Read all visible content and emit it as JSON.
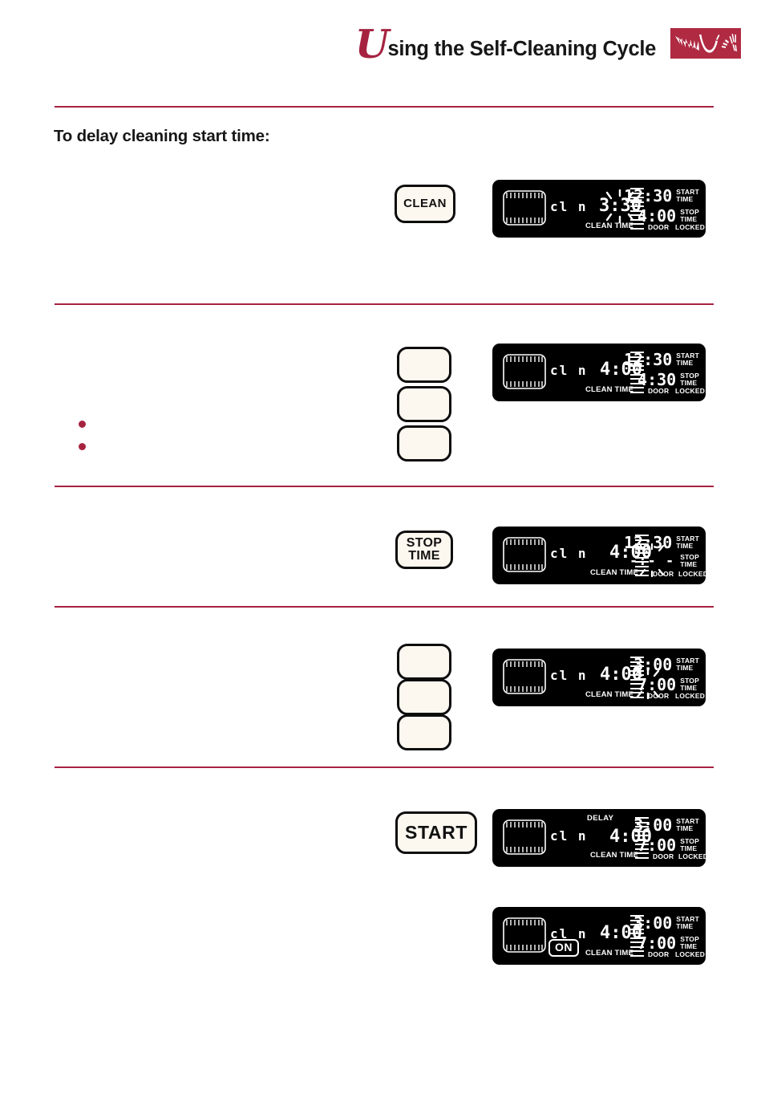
{
  "header": {
    "title_first_letter": "U",
    "title_rest": "sing the Self-Cleaning Cycle",
    "logo_name": "whirlpool-brush-logo"
  },
  "section": {
    "heading": "To delay cleaning start time:"
  },
  "labels": {
    "clean_time": "CLEAN TIME",
    "door": "DOOR",
    "locked": "LOCKED",
    "delay": "DELAY",
    "start_time": "START\nTIME",
    "start_time_line1": "START",
    "start_time_line2": "TIME",
    "stop_time_line1": "STOP",
    "stop_time_line2": "TIME",
    "cln": "cl n",
    "on": "ON",
    "blank_time": "-:- -"
  },
  "steps": [
    {
      "id": "step-clean",
      "button": {
        "name": "clean-button",
        "label": "CLEAN",
        "style": "small"
      },
      "display": {
        "mode": "cl n",
        "clean_time": "3:30",
        "clean_time_blinking": true,
        "start_time": "12:30",
        "start_time_blinking": false,
        "stop_time": "4:00",
        "stop_time_blinking": false,
        "delay_shown": false,
        "on_shown": false
      }
    },
    {
      "id": "step-set-clean-time",
      "buttons_blank_count": 3,
      "bullets": 2,
      "display": {
        "mode": "cl n",
        "clean_time": "4:00",
        "clean_time_blinking": false,
        "start_time": "12:30",
        "start_time_blinking": false,
        "stop_time": "4:30",
        "stop_time_blinking": false,
        "delay_shown": false,
        "on_shown": false
      }
    },
    {
      "id": "step-stop-time",
      "button": {
        "name": "stop-time-button",
        "label_line1": "STOP",
        "label_line2": "TIME",
        "style": "two-line"
      },
      "display": {
        "mode": "cl n",
        "clean_time": "4:00",
        "clean_time_blinking": false,
        "start_time": "12:30",
        "start_time_blinking": false,
        "stop_time": "-:- -",
        "stop_time_blinking": true,
        "delay_shown": false,
        "on_shown": false
      }
    },
    {
      "id": "step-set-stop-time",
      "buttons_blank_count": 3,
      "display": {
        "mode": "cl n",
        "clean_time": "4:00",
        "clean_time_blinking": false,
        "start_time": "3:00",
        "start_time_blinking": false,
        "stop_time": "7:00",
        "stop_time_blinking": true,
        "delay_shown": false,
        "on_shown": false
      }
    },
    {
      "id": "step-start",
      "button": {
        "name": "start-button",
        "label": "START",
        "style": "big"
      },
      "display": {
        "mode": "cl n",
        "clean_time": "4:00",
        "clean_time_blinking": false,
        "start_time": "3:00",
        "start_time_blinking": false,
        "stop_time": "7:00",
        "stop_time_blinking": false,
        "delay_shown": true,
        "on_shown": false
      }
    },
    {
      "id": "step-running",
      "display": {
        "mode": "cl n",
        "clean_time": "4:00",
        "clean_time_blinking": false,
        "start_time": "3:00",
        "start_time_blinking": false,
        "stop_time": "7:00",
        "stop_time_blinking": false,
        "delay_shown": false,
        "on_shown": true
      }
    }
  ],
  "colors": {
    "accent_red": "#A62340",
    "logo_red": "#B02A42",
    "button_face": "#FCF8F0",
    "lcd_background": "#000000",
    "lcd_text": "#FFFFFF"
  }
}
